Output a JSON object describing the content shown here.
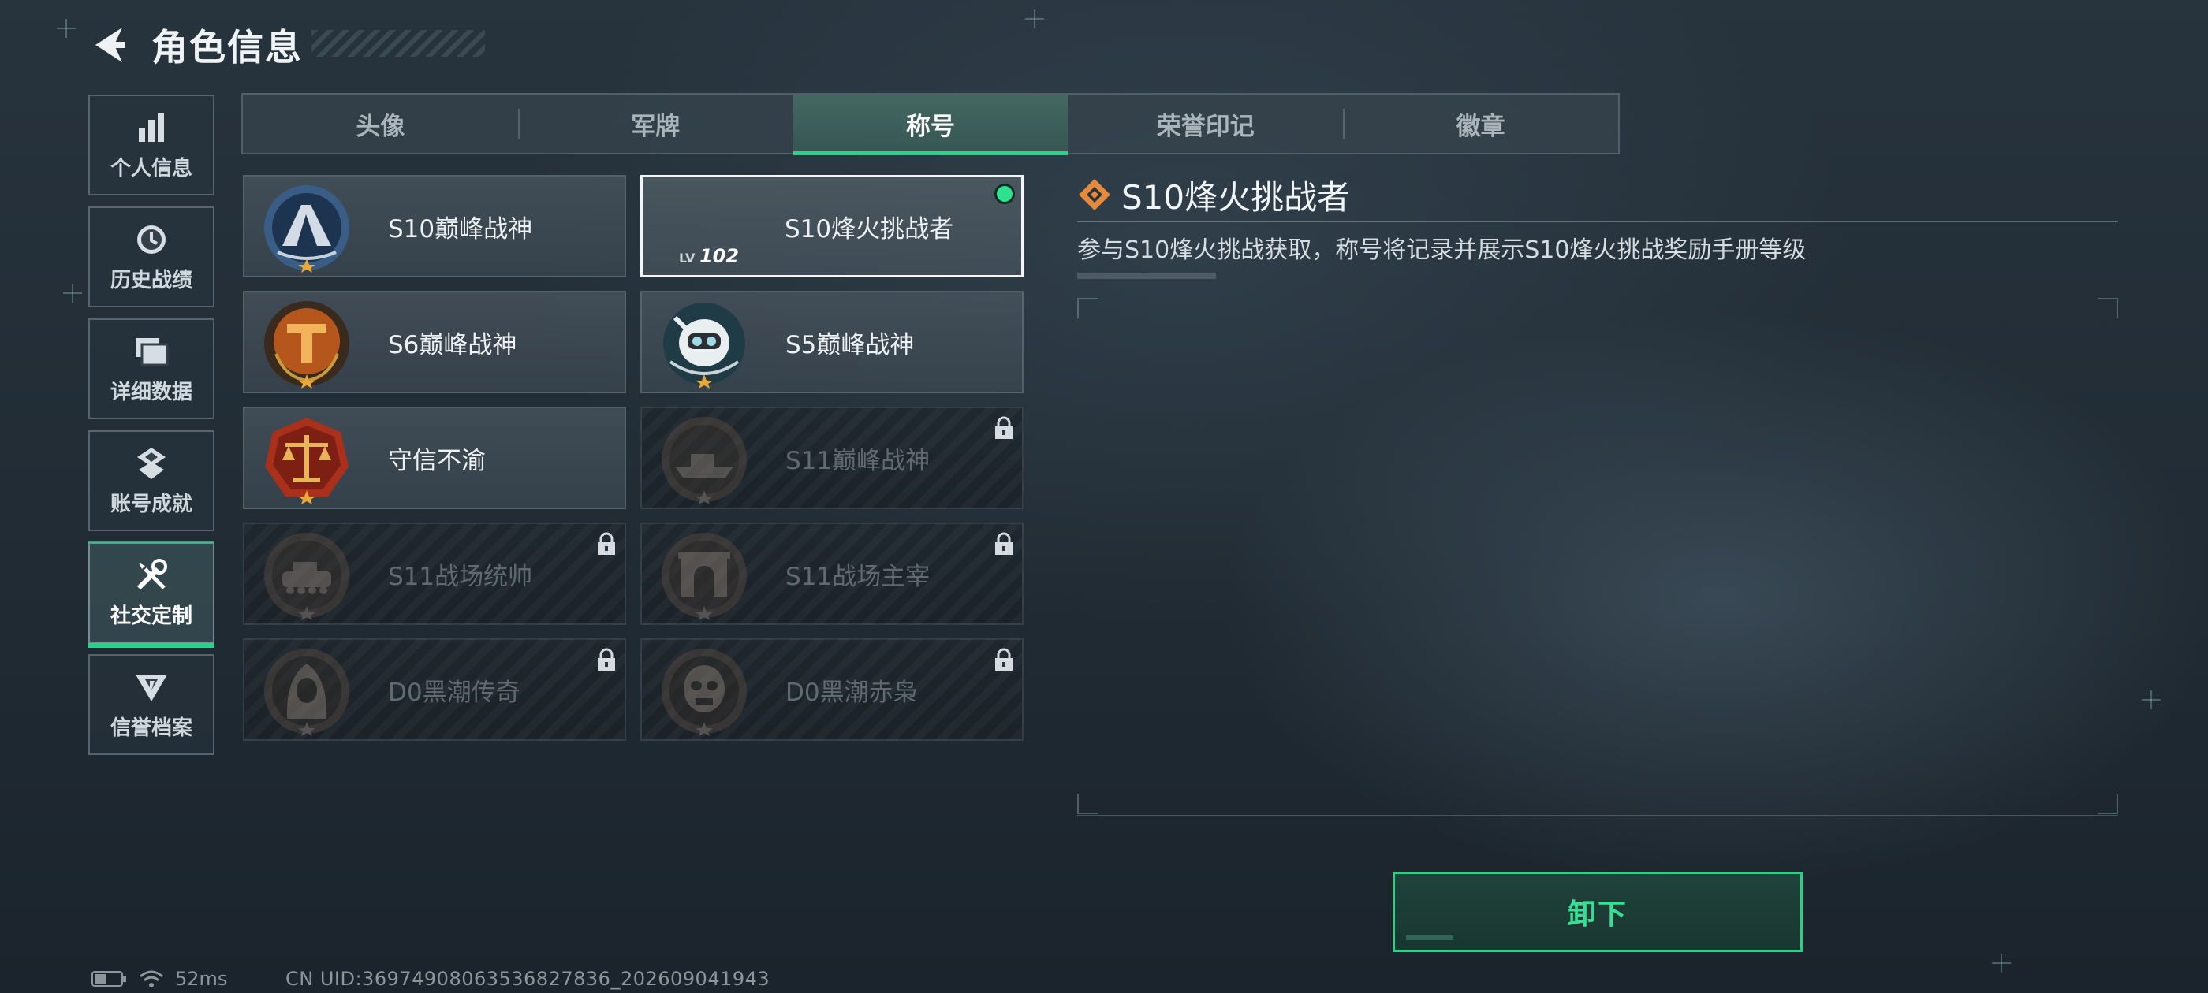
{
  "header": {
    "title": "角色信息"
  },
  "sidebar": {
    "items": [
      {
        "label": "个人信息",
        "icon": "bar-chart-icon",
        "active": false
      },
      {
        "label": "历史战绩",
        "icon": "clock-icon",
        "active": false
      },
      {
        "label": "详细数据",
        "icon": "folder-icon",
        "active": false
      },
      {
        "label": "账号成就",
        "icon": "achievement-icon",
        "active": false
      },
      {
        "label": "社交定制",
        "icon": "wrench-screwdriver-icon",
        "active": true
      },
      {
        "label": "信誉档案",
        "icon": "shield-v-icon",
        "active": false
      }
    ]
  },
  "tabs": [
    {
      "label": "头像",
      "active": false
    },
    {
      "label": "军牌",
      "active": false
    },
    {
      "label": "称号",
      "active": true
    },
    {
      "label": "荣誉印记",
      "active": false
    },
    {
      "label": "徽章",
      "active": false
    }
  ],
  "titles": [
    {
      "name": "S10巅峰战神",
      "locked": false,
      "selected": false,
      "emblem": "summit-emblem-icon",
      "color": "#3a5d86"
    },
    {
      "name": "S10烽火挑战者",
      "locked": false,
      "selected": true,
      "equipped": true,
      "level_prefix": "LV",
      "level": "102",
      "emblem": "none",
      "color": "#000000"
    },
    {
      "name": "S6巅峰战神",
      "locked": false,
      "selected": false,
      "emblem": "t-emblem-icon",
      "color": "#b5571c"
    },
    {
      "name": "S5巅峰战神",
      "locked": false,
      "selected": false,
      "emblem": "diver-skull-emblem-icon",
      "color": "#1f3b45"
    },
    {
      "name": "守信不渝",
      "locked": false,
      "selected": false,
      "emblem": "scales-emblem-icon",
      "color": "#a9311c"
    },
    {
      "name": "S11巅峰战神",
      "locked": true,
      "selected": false,
      "emblem": "ship-emblem-icon",
      "color": "#6b4a31"
    },
    {
      "name": "S11战场统帅",
      "locked": true,
      "selected": false,
      "emblem": "tank-emblem-icon",
      "color": "#6b4a31"
    },
    {
      "name": "S11战场主宰",
      "locked": true,
      "selected": false,
      "emblem": "arch-emblem-icon",
      "color": "#6b4a31"
    },
    {
      "name": "D0黑潮传奇",
      "locked": true,
      "selected": false,
      "emblem": "hooded-figure-emblem-icon",
      "color": "#6b4a31"
    },
    {
      "name": "D0黑潮赤枭",
      "locked": true,
      "selected": false,
      "emblem": "masked-skull-emblem-icon",
      "color": "#6b4a31"
    }
  ],
  "detail": {
    "title": "S10烽火挑战者",
    "description": "参与S10烽火挑战获取，称号将记录并展示S10烽火挑战奖励手册等级"
  },
  "unequip_label": "卸下",
  "status": {
    "ping": "52ms",
    "uid": "CN UID:36974908063536827836_202609041943"
  },
  "colors": {
    "accent_green": "#31d08a",
    "equipped_dot": "#2fe08e",
    "detail_diamond": "#e58a3a"
  }
}
